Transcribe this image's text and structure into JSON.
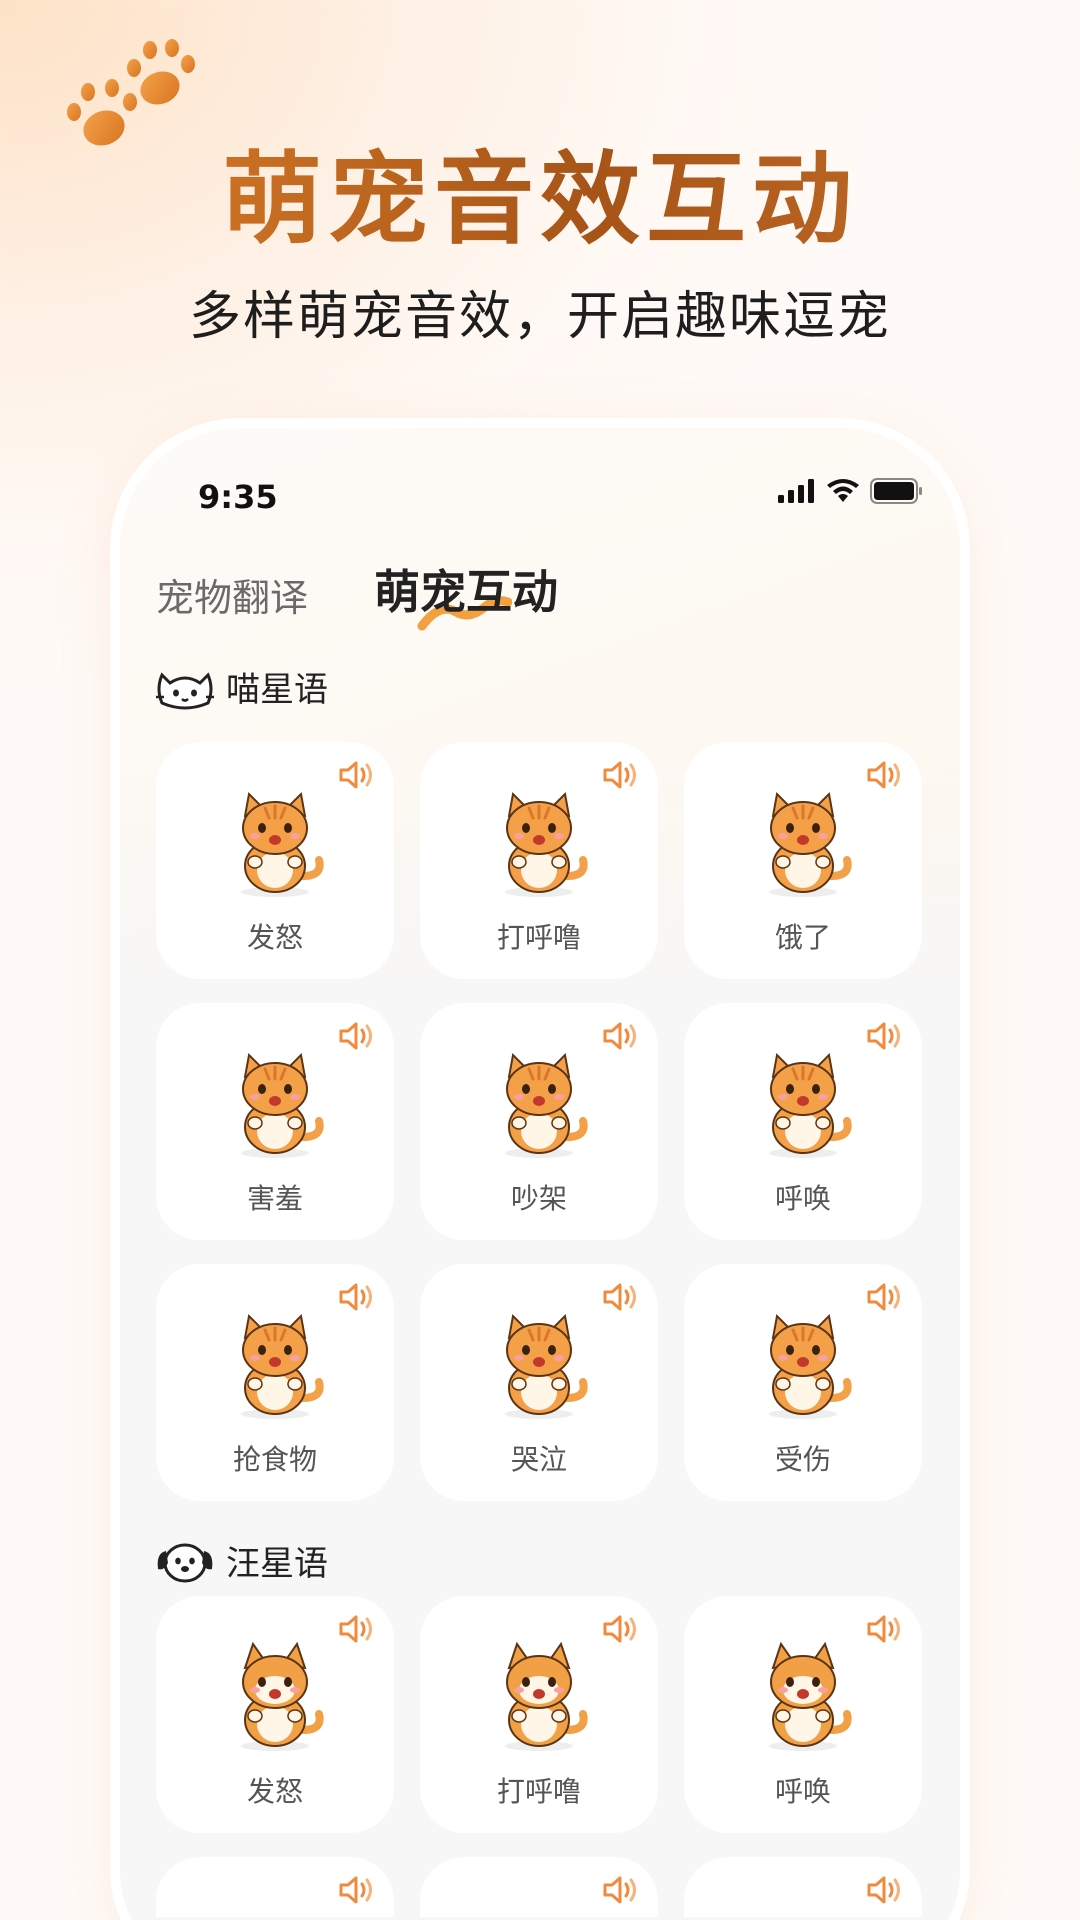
{
  "promo": {
    "title": "萌宠音效互动",
    "subtitle": "多样萌宠音效，开启趣味逗宠"
  },
  "status_bar": {
    "time": "9:35",
    "icons": [
      "signal-icon",
      "wifi-icon",
      "battery-icon"
    ]
  },
  "tabs": [
    {
      "label": "宠物翻译",
      "active": false
    },
    {
      "label": "萌宠互动",
      "active": true
    }
  ],
  "sections": [
    {
      "title": "喵星语",
      "icon": "cat-face-icon",
      "cards": [
        {
          "label": "发怒",
          "icon": "cat-angry-icon"
        },
        {
          "label": "打呼噜",
          "icon": "cat-sleeping-icon"
        },
        {
          "label": "饿了",
          "icon": "cat-hungry-icon"
        },
        {
          "label": "害羞",
          "icon": "cat-shy-icon"
        },
        {
          "label": "吵架",
          "icon": "cat-quarrel-icon"
        },
        {
          "label": "呼唤",
          "icon": "cat-calling-icon"
        },
        {
          "label": "抢食物",
          "icon": "cat-grab-food-icon"
        },
        {
          "label": "哭泣",
          "icon": "cat-crying-icon"
        },
        {
          "label": "受伤",
          "icon": "cat-injured-icon"
        }
      ]
    },
    {
      "title": "汪星语",
      "icon": "dog-face-icon",
      "cards": [
        {
          "label": "发怒",
          "icon": "dog-angry-icon"
        },
        {
          "label": "打呼噜",
          "icon": "dog-sleeping-icon"
        },
        {
          "label": "呼唤",
          "icon": "dog-calling-icon"
        }
      ]
    }
  ],
  "colors": {
    "accent": "#f08a3c",
    "pet_orange": "#f4a048",
    "title_gradient": [
      "#e1822a",
      "#a65418"
    ]
  }
}
